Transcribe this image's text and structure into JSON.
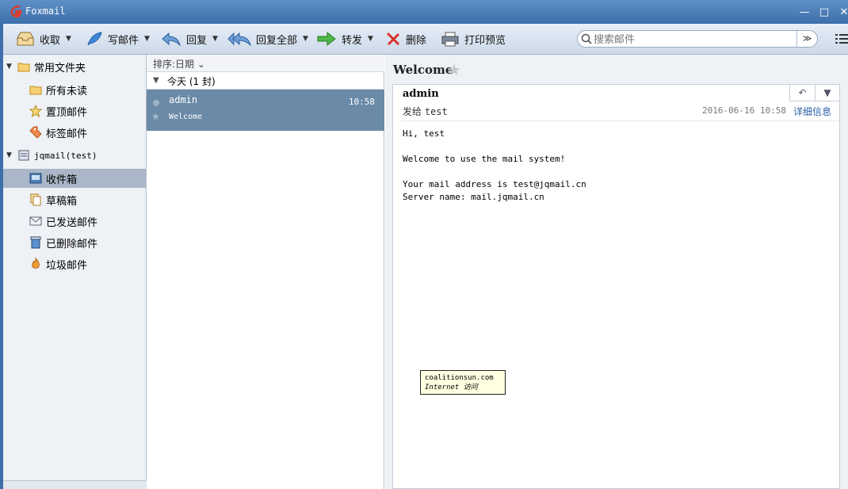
{
  "window": {
    "title": "Foxmail",
    "minimize": "—",
    "maximize": "□",
    "close": "✕"
  },
  "toolbar": {
    "receive": "收取",
    "compose": "写邮件",
    "reply": "回复",
    "reply_all": "回复全部",
    "forward": "转发",
    "delete": "删除",
    "print_preview": "打印预览",
    "dropdown_glyph": "▼"
  },
  "search": {
    "placeholder": "搜索邮件",
    "dropdown_glyph": "≫"
  },
  "sidebar": {
    "common_group": "常用文件夹",
    "common_items": [
      {
        "label": "所有未读",
        "icon": "folder-icon"
      },
      {
        "label": "置顶邮件",
        "icon": "star-icon"
      },
      {
        "label": "标签邮件",
        "icon": "tag-icon"
      }
    ],
    "account": "jqmail(test)",
    "account_items": [
      {
        "label": "收件箱",
        "icon": "inbox-icon",
        "selected": true
      },
      {
        "label": "草稿箱",
        "icon": "drafts-icon"
      },
      {
        "label": "已发送邮件",
        "icon": "sent-icon"
      },
      {
        "label": "已删除邮件",
        "icon": "trash-icon"
      },
      {
        "label": "垃圾邮件",
        "icon": "junk-icon"
      }
    ],
    "expand_glyph": "▼"
  },
  "maillist": {
    "sort_label": "排序:日期 ⌄",
    "group_label": "今天 (1 封)",
    "messages": [
      {
        "sender": "admin",
        "time": "10:58",
        "subject": "Welcome"
      }
    ]
  },
  "reader": {
    "title": "Welcome",
    "from": "admin",
    "to_prefix": "发给",
    "to": "test",
    "date": "2016-06-16 10:58",
    "detail_link": "详细信息",
    "body": "Hi, test\n\nWelcome to use the mail system!\n\nYour mail address is test@jqmail.cn\nServer name: mail.jqmail.cn"
  },
  "tooltip": {
    "line1": "coalitionsun.com",
    "line2": "Internet 访问"
  },
  "colors": {
    "titlebar": "#3d6fab",
    "selected_row": "#6a8aa7",
    "selected_folder": "#a9b7c8",
    "link": "#2a5fa8"
  }
}
